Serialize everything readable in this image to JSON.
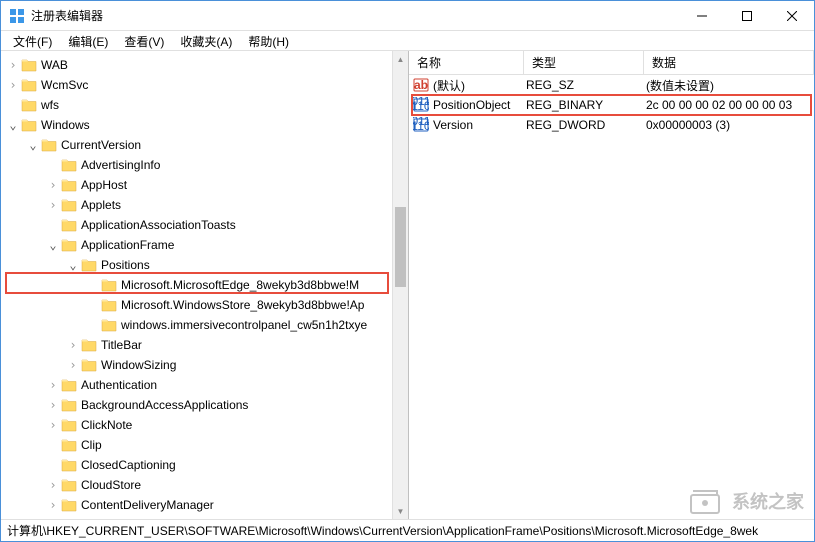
{
  "window": {
    "title": "注册表编辑器"
  },
  "menu": {
    "file": "文件(F)",
    "edit": "编辑(E)",
    "view": "查看(V)",
    "favorites": "收藏夹(A)",
    "help": "帮助(H)"
  },
  "tree": {
    "items": [
      {
        "label": "WAB",
        "depth": 1,
        "expander": ">"
      },
      {
        "label": "WcmSvc",
        "depth": 1,
        "expander": ">"
      },
      {
        "label": "wfs",
        "depth": 1,
        "expander": ""
      },
      {
        "label": "Windows",
        "depth": 1,
        "expander": "v"
      },
      {
        "label": "CurrentVersion",
        "depth": 2,
        "expander": "v"
      },
      {
        "label": "AdvertisingInfo",
        "depth": 3,
        "expander": ""
      },
      {
        "label": "AppHost",
        "depth": 3,
        "expander": ">"
      },
      {
        "label": "Applets",
        "depth": 3,
        "expander": ">"
      },
      {
        "label": "ApplicationAssociationToasts",
        "depth": 3,
        "expander": ""
      },
      {
        "label": "ApplicationFrame",
        "depth": 3,
        "expander": "v"
      },
      {
        "label": "Positions",
        "depth": 4,
        "expander": "v"
      },
      {
        "label": "Microsoft.MicrosoftEdge_8wekyb3d8bbwe!M",
        "depth": 5,
        "expander": "",
        "hl": true
      },
      {
        "label": "Microsoft.WindowsStore_8wekyb3d8bbwe!Ap",
        "depth": 5,
        "expander": ""
      },
      {
        "label": "windows.immersivecontrolpanel_cw5n1h2txye",
        "depth": 5,
        "expander": ""
      },
      {
        "label": "TitleBar",
        "depth": 4,
        "expander": ">"
      },
      {
        "label": "WindowSizing",
        "depth": 4,
        "expander": ">"
      },
      {
        "label": "Authentication",
        "depth": 3,
        "expander": ">"
      },
      {
        "label": "BackgroundAccessApplications",
        "depth": 3,
        "expander": ">"
      },
      {
        "label": "ClickNote",
        "depth": 3,
        "expander": ">"
      },
      {
        "label": "Clip",
        "depth": 3,
        "expander": ""
      },
      {
        "label": "ClosedCaptioning",
        "depth": 3,
        "expander": ""
      },
      {
        "label": "CloudStore",
        "depth": 3,
        "expander": ">"
      },
      {
        "label": "ContentDeliveryManager",
        "depth": 3,
        "expander": ">"
      }
    ]
  },
  "list": {
    "headers": {
      "name": "名称",
      "type": "类型",
      "data": "数据"
    },
    "rows": [
      {
        "icon": "string",
        "name": "(默认)",
        "type": "REG_SZ",
        "data": "(数值未设置)"
      },
      {
        "icon": "binary",
        "name": "PositionObject",
        "type": "REG_BINARY",
        "data": "2c 00 00 00 02 00 00 00 03",
        "hl": true
      },
      {
        "icon": "binary",
        "name": "Version",
        "type": "REG_DWORD",
        "data": "0x00000003 (3)"
      }
    ]
  },
  "statusbar": {
    "path": "计算机\\HKEY_CURRENT_USER\\SOFTWARE\\Microsoft\\Windows\\CurrentVersion\\ApplicationFrame\\Positions\\Microsoft.MicrosoftEdge_8wek"
  },
  "watermark": {
    "text": "系统之家"
  }
}
